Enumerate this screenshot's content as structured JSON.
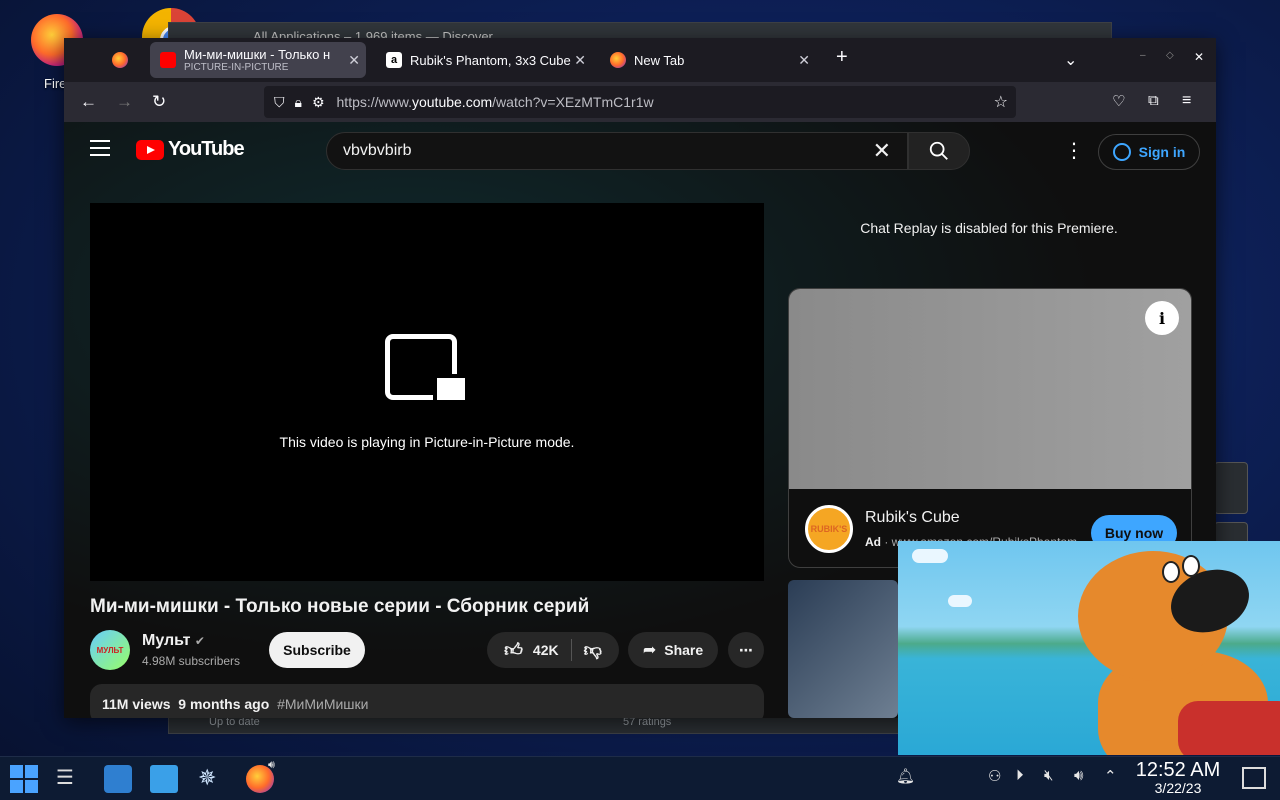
{
  "desktop": {
    "firefox_label": "Firef"
  },
  "bg_window": {
    "title": "All Applications – 1,969 items — Discover",
    "bottom_left": "Up to date",
    "bottom_ratings": "57 ratings"
  },
  "browser": {
    "tabs": [
      {
        "title": "Ми-ми-мишки - Только н",
        "subtitle": "PICTURE-IN-PICTURE"
      },
      {
        "title": "Rubik's Phantom, 3x3 Cube"
      },
      {
        "title": "New Tab"
      }
    ],
    "new_tab": "+",
    "url_dim": "https://www.",
    "url_main": "youtube.com",
    "url_rest": "/watch?v=XEzMTmC1r1w"
  },
  "youtube": {
    "logo": "YouTube",
    "search_query": "vbvbvbirb",
    "sign_in": "Sign in",
    "pip_message": "This video is playing in Picture-in-Picture mode.",
    "chat_note": "Chat Replay is disabled for this Premiere.",
    "ad": {
      "title": "Rubik's Cube",
      "label": "Ad",
      "domain": "www.amazon.com/RubiksPhantom",
      "button": "Buy now",
      "logo_text": "RUBIK'S"
    },
    "video": {
      "title": "Ми-ми-мишки - Только новые серии - Сборник серий",
      "channel": "Мульт",
      "channel_logo": "МУЛЬТ",
      "subscribers": "4.98M subscribers",
      "subscribe": "Subscribe",
      "likes": "42K",
      "share": "Share",
      "views": "11M views",
      "age": "9 months ago",
      "hashtag": "#МиМиМишки"
    }
  },
  "taskbar": {
    "time": "12:52 AM",
    "date": "3/22/23"
  },
  "colors": {
    "yt_red": "#ff0000",
    "link_blue": "#3ea6ff",
    "taskbar": "#0d1b33"
  }
}
